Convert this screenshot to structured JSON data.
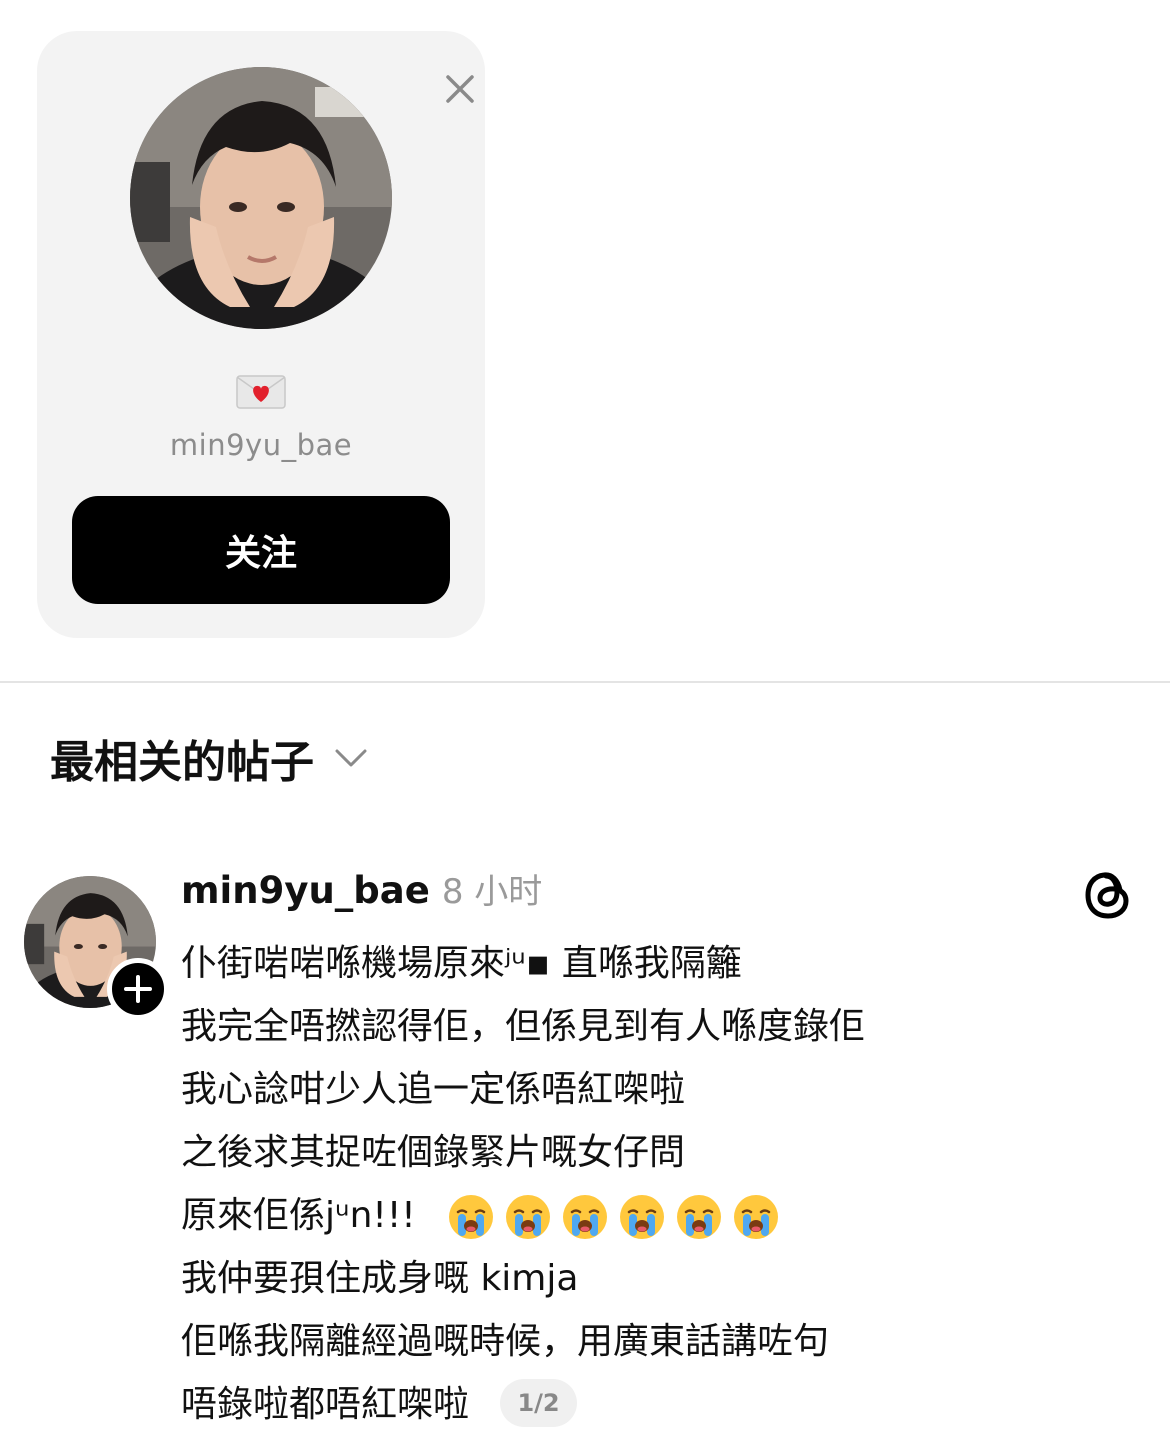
{
  "suggestion_card": {
    "username": "min9yu_bae",
    "bio_icon": "love-letter-emoji",
    "follow_label": "关注",
    "close_icon": "close-icon"
  },
  "section": {
    "title": "最相关的帖子",
    "chevron_icon": "chevron-down-icon"
  },
  "post": {
    "username": "min9yu_bae",
    "time": "8 小时",
    "app_icon": "threads-icon",
    "lines": [
      "仆街啱啱喺機場原來ʲᵘ▪︎    直喺我隔籬",
      "我完全唔撚認得佢，但係見到有人喺度錄佢",
      "我心諗咁少人追一定係唔紅㗎啦",
      "之後求其捉咗個錄緊片嘅女仔問",
      "原來佢係jᵘn!!!",
      "我仲要孭住成身嘅 kimja",
      "佢喺我隔離經過嘅時候，用廣東話講咗句",
      "唔錄啦都唔紅㗎啦"
    ],
    "emoji_count": 6,
    "emoji_name": "loudly-crying-face-emoji",
    "page_indicator": "1/2"
  },
  "colors": {
    "card_bg": "#f3f3f3",
    "button_bg": "#000000",
    "muted_text": "#9a9a9a"
  }
}
